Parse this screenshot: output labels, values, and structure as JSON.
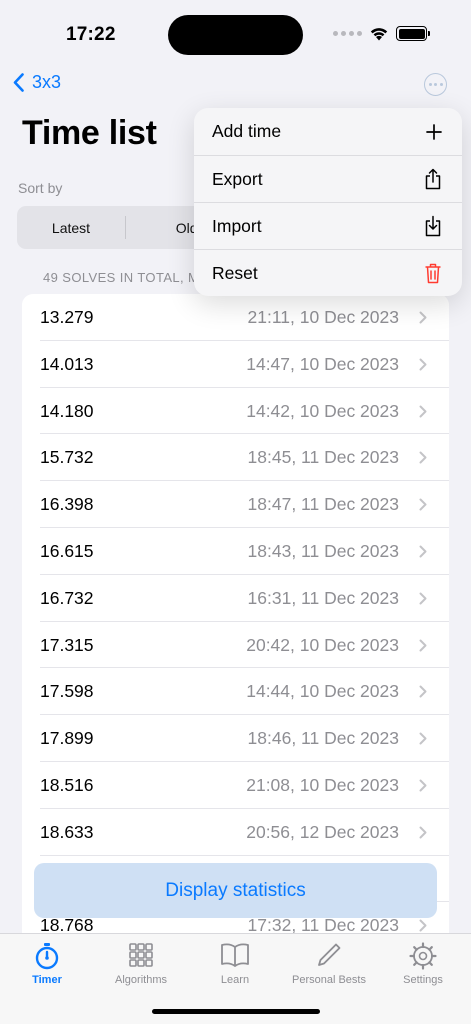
{
  "status_bar": {
    "time": "17:22"
  },
  "nav": {
    "back_label": "3x3"
  },
  "page_title": "Time list",
  "sort": {
    "label": "Sort by",
    "options": [
      "Latest",
      "Oldes"
    ]
  },
  "summary": "49 SOLVES IN TOTAL, M",
  "solves": [
    {
      "time": "13.279",
      "date": "21:11, 10 Dec 2023"
    },
    {
      "time": "14.013",
      "date": "14:47, 10 Dec 2023"
    },
    {
      "time": "14.180",
      "date": "14:42, 10 Dec 2023"
    },
    {
      "time": "15.732",
      "date": "18:45, 11 Dec 2023"
    },
    {
      "time": "16.398",
      "date": "18:47, 11 Dec 2023"
    },
    {
      "time": "16.615",
      "date": "18:43, 11 Dec 2023"
    },
    {
      "time": "16.732",
      "date": "16:31, 11 Dec 2023"
    },
    {
      "time": "17.315",
      "date": "20:42, 10 Dec 2023"
    },
    {
      "time": "17.598",
      "date": "14:44, 10 Dec 2023"
    },
    {
      "time": "17.899",
      "date": "18:46, 11 Dec 2023"
    },
    {
      "time": "18.516",
      "date": "21:08, 10 Dec 2023"
    },
    {
      "time": "18.633",
      "date": "20:56, 12 Dec 2023"
    },
    {
      "time": "",
      "date": ""
    },
    {
      "time": "18.768",
      "date": "17:32, 11 Dec 2023"
    }
  ],
  "stats_button": "Display statistics",
  "menu": {
    "items": [
      {
        "label": "Add time",
        "icon": "plus-icon"
      },
      {
        "label": "Export",
        "icon": "share-icon"
      },
      {
        "label": "Import",
        "icon": "import-icon"
      },
      {
        "label": "Reset",
        "icon": "trash-icon"
      }
    ]
  },
  "tabs": [
    {
      "label": "Timer",
      "icon": "stopwatch-icon",
      "active": true
    },
    {
      "label": "Algorithms",
      "icon": "grid-icon",
      "active": false
    },
    {
      "label": "Learn",
      "icon": "book-icon",
      "active": false
    },
    {
      "label": "Personal Bests",
      "icon": "pencil-icon",
      "active": false
    },
    {
      "label": "Settings",
      "icon": "gear-icon",
      "active": false
    }
  ],
  "colors": {
    "accent": "#0a7aff",
    "destructive": "#ff3b30",
    "secondary_text": "#8e8e93"
  }
}
